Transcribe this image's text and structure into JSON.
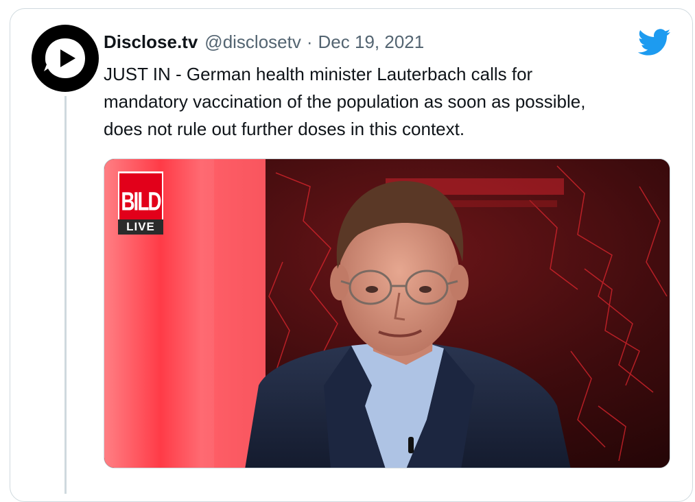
{
  "tweet": {
    "author": {
      "display_name": "Disclose.tv",
      "handle": "@disclosetv",
      "avatar_icon": "disclose-tv-play-logo"
    },
    "separator": "·",
    "date": "Dec 19, 2021",
    "text_lines": [
      "JUST IN - German health minister Lauterbach calls for",
      "mandatory vaccination of the population as soon as possible,",
      "does not rule out further doses in this context."
    ],
    "brand_icon": "twitter-bird-icon",
    "brand_color": "#1d9bf0",
    "media": {
      "type": "video-still",
      "overlay_logo": {
        "brand": "BILD",
        "sub": "LIVE"
      }
    }
  }
}
